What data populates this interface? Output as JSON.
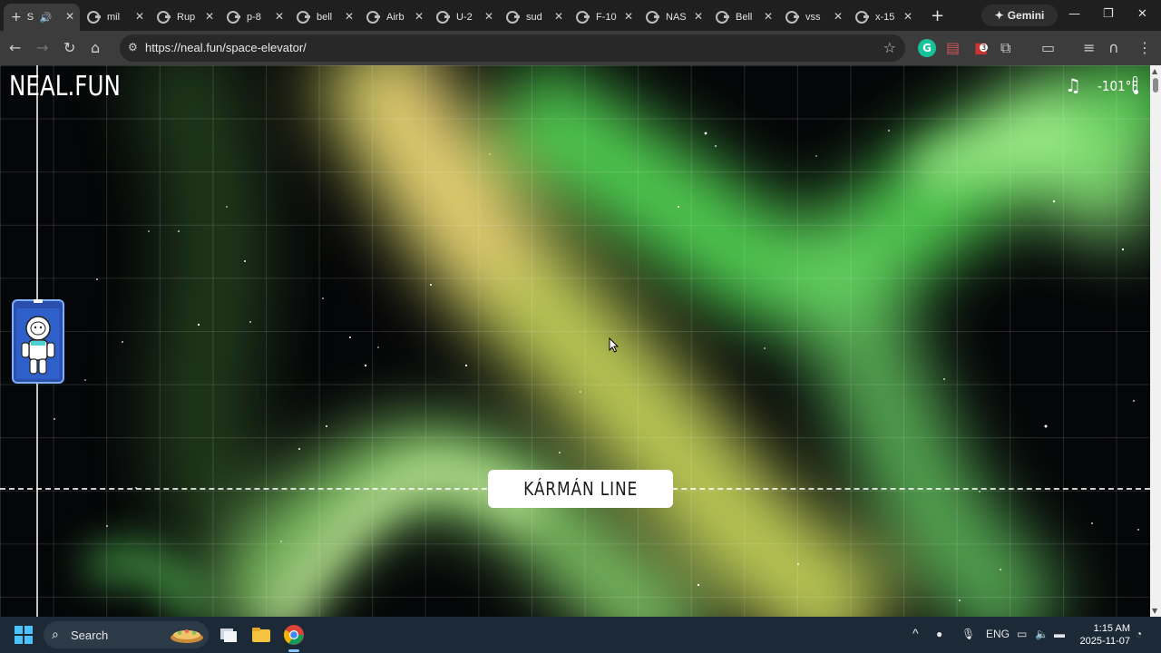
{
  "browser": {
    "active_tab": {
      "label": "S",
      "audio_icon": "speaker-icon"
    },
    "tabs": [
      {
        "label": "mil"
      },
      {
        "label": "Rup"
      },
      {
        "label": "p-8"
      },
      {
        "label": "bell"
      },
      {
        "label": "Airb"
      },
      {
        "label": "U-2"
      },
      {
        "label": "sud"
      },
      {
        "label": "F-10"
      },
      {
        "label": "NAS"
      },
      {
        "label": "Bell"
      },
      {
        "label": "vss"
      },
      {
        "label": "x-15"
      }
    ],
    "gemini_label": "Gemini",
    "url": "https://neal.fun/space-elevator/",
    "extension_badge": "3"
  },
  "page": {
    "logo": "NEAL.FUN",
    "temperature": "-101°F",
    "karman_label": "KÁRMÁN LINE",
    "colors": {
      "sky": "#050608",
      "aurora_green": "#6cf26a",
      "aurora_yellow": "#f7e27a",
      "elevator_blue": "#2f5fc9"
    }
  },
  "taskbar": {
    "search_label": "Search",
    "language": "ENG",
    "time": "1:15 AM",
    "date": "2025-11-07"
  }
}
